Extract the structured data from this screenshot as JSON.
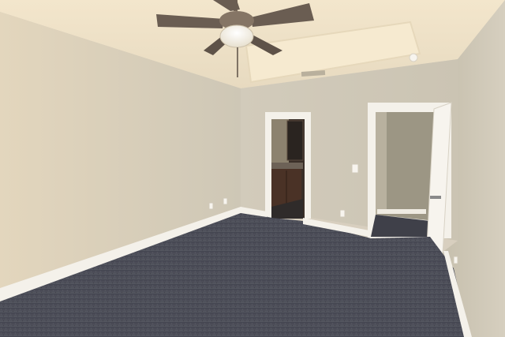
{
  "scene": {
    "subject": "empty-bedroom",
    "features": [
      "ceiling-fan",
      "tray-ceiling",
      "carpet-floor",
      "bathroom-doorway",
      "closet-door",
      "baseboards",
      "light-switch",
      "outlets"
    ],
    "colors": {
      "wall_lit": "#dbd1bf",
      "wall_shade": "#c9c2b0",
      "ceiling": "#f0e3c8",
      "carpet": "#4e4f58",
      "trim": "#f4f1ea",
      "cabinet": "#4a3226",
      "fan_blade": "#6a5d52"
    }
  }
}
